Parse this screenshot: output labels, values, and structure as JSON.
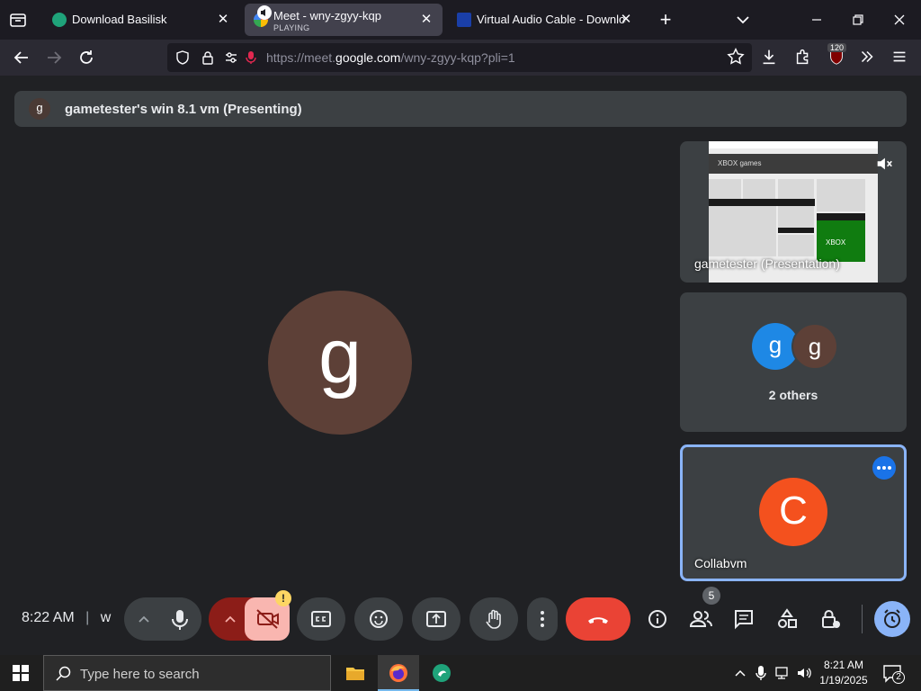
{
  "browser": {
    "tabs": [
      {
        "title": "Download Basilisk",
        "favicon": "basilisk-icon",
        "sub": ""
      },
      {
        "title": "Meet - wny-zgyy-kqp",
        "favicon": "google-meet-icon",
        "sub": "PLAYING"
      },
      {
        "title": "Virtual Audio Cable - Downloa",
        "favicon": "vac-icon",
        "sub": ""
      }
    ],
    "new_tab_label": "+",
    "url_prefix": "https://meet.",
    "url_domain": "google.com",
    "url_path": "/wny-zgyy-kqp?pli=1",
    "extension_badge": "120"
  },
  "meet": {
    "banner_avatar": "g",
    "banner_text": "gametester's win 8.1 vm (Presenting)",
    "main_avatar": "g",
    "tiles": {
      "presentation_label": "gametester (Presentation)",
      "thumb_header": "XBOX games",
      "thumb_brand": "XBOX",
      "others_avatar_1": "g",
      "others_avatar_2": "g",
      "others_label": "2 others",
      "collab_avatar": "C",
      "collab_label": "Collabvm"
    },
    "controls": {
      "time": "8:22 AM",
      "separator": "|",
      "meeting_code_partial": "w",
      "camera_warning": "!",
      "participants_count": "5"
    }
  },
  "taskbar": {
    "search_placeholder": "Type here to search",
    "time": "8:21 AM",
    "date": "1/19/2025",
    "notification_count": "2"
  },
  "colors": {
    "meet_bg": "#202124",
    "tile_bg": "#3c4043",
    "end_call": "#ea4335",
    "active_tile_border": "#8ab4f8",
    "collab_avatar": "#f4511e",
    "main_avatar": "#5d4037"
  }
}
